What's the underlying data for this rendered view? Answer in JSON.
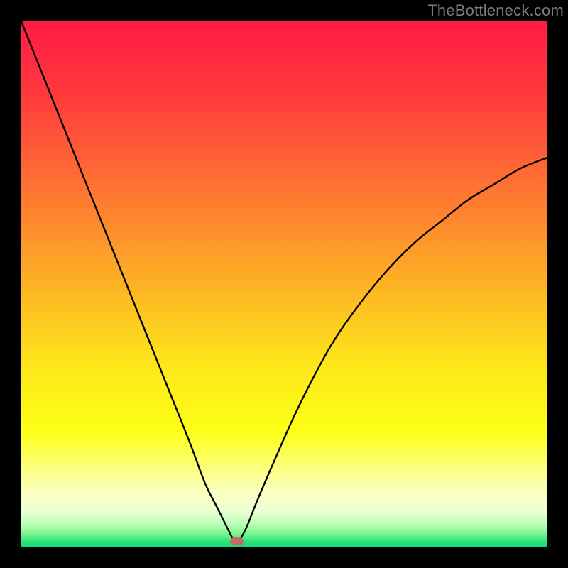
{
  "watermark": {
    "text": "TheBottleneck.com"
  },
  "chart_data": {
    "type": "line",
    "title": "",
    "xlabel": "",
    "ylabel": "",
    "xlim": [
      0,
      100
    ],
    "ylim": [
      0,
      100
    ],
    "minimum_marker": {
      "x": 41,
      "y": 1,
      "color": "#c76b62"
    },
    "background": {
      "gradient_stops": [
        {
          "offset": 0,
          "color": "#ff1b45"
        },
        {
          "offset": 0.14,
          "color": "#ff3a3c"
        },
        {
          "offset": 0.32,
          "color": "#fe7432"
        },
        {
          "offset": 0.5,
          "color": "#fdb224"
        },
        {
          "offset": 0.66,
          "color": "#fde81a"
        },
        {
          "offset": 0.78,
          "color": "#feff16"
        },
        {
          "offset": 0.85,
          "color": "#fbff7d"
        },
        {
          "offset": 0.895,
          "color": "#fbffc0"
        },
        {
          "offset": 0.93,
          "color": "#eeffd4"
        },
        {
          "offset": 0.955,
          "color": "#c1ffb9"
        },
        {
          "offset": 0.975,
          "color": "#7df58f"
        },
        {
          "offset": 0.99,
          "color": "#2be57a"
        },
        {
          "offset": 1.0,
          "color": "#0fdd7b"
        }
      ]
    },
    "series": [
      {
        "name": "bottleneck-curve",
        "color": "#000000",
        "x": [
          0,
          4,
          8,
          12,
          16,
          20,
          24,
          28,
          32,
          35,
          37,
          39,
          40,
          41,
          42,
          43,
          45,
          48,
          52,
          56,
          60,
          65,
          70,
          75,
          80,
          85,
          90,
          95,
          100
        ],
        "values": [
          100,
          90,
          80,
          70,
          60,
          50,
          40,
          30,
          20,
          12,
          8,
          4,
          2,
          0.5,
          2,
          4,
          9,
          16,
          25,
          33,
          40,
          47,
          53,
          58,
          62,
          66,
          69,
          72,
          74
        ]
      }
    ]
  }
}
